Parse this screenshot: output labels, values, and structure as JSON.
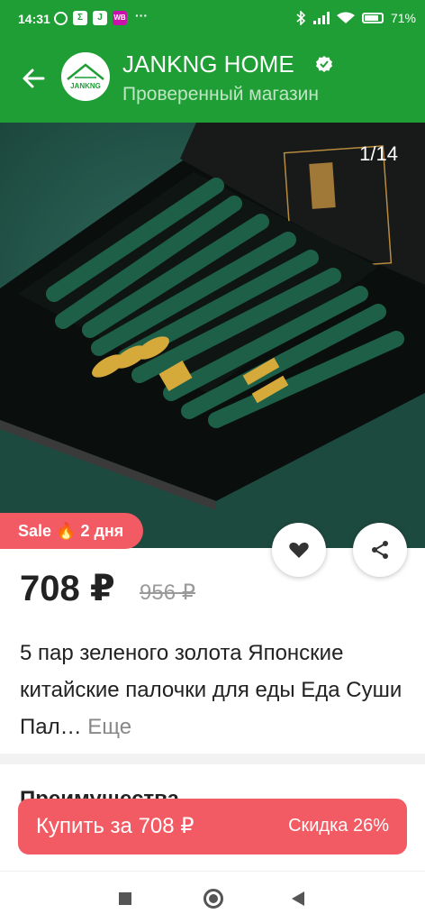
{
  "status_bar": {
    "time": "14:31",
    "battery": "71%",
    "app_icons": [
      "alarm-icon",
      "sigma-icon",
      "j-icon",
      "wb-icon",
      "more-dots-icon"
    ],
    "sigma_label": "Σ",
    "j_label": "J",
    "wb_label": "WB",
    "dots_label": "···"
  },
  "header": {
    "store_name": "JANKNG HOME",
    "store_subtitle": "Проверенный магазин",
    "logo_text": "JANKNG",
    "verified": true,
    "background_color": "#1f9e35"
  },
  "gallery": {
    "counter": "1/14"
  },
  "sale_badge": {
    "label": "Sale 🔥 2 дня",
    "color": "#f25b63"
  },
  "price": {
    "current": "708 ₽",
    "old": "956 ₽"
  },
  "product": {
    "title": "5 пар зеленого золота Японские китайские палочки для еды Еда Суши Пал…",
    "more_label": "Еще"
  },
  "section": {
    "peek_title": "Преимущества"
  },
  "buy_button": {
    "label": "Купить за 708 ₽",
    "discount": "Скидка 26%",
    "color": "#f25b63"
  },
  "nav": {
    "items": [
      "recents-button",
      "home-button",
      "back-button"
    ]
  }
}
